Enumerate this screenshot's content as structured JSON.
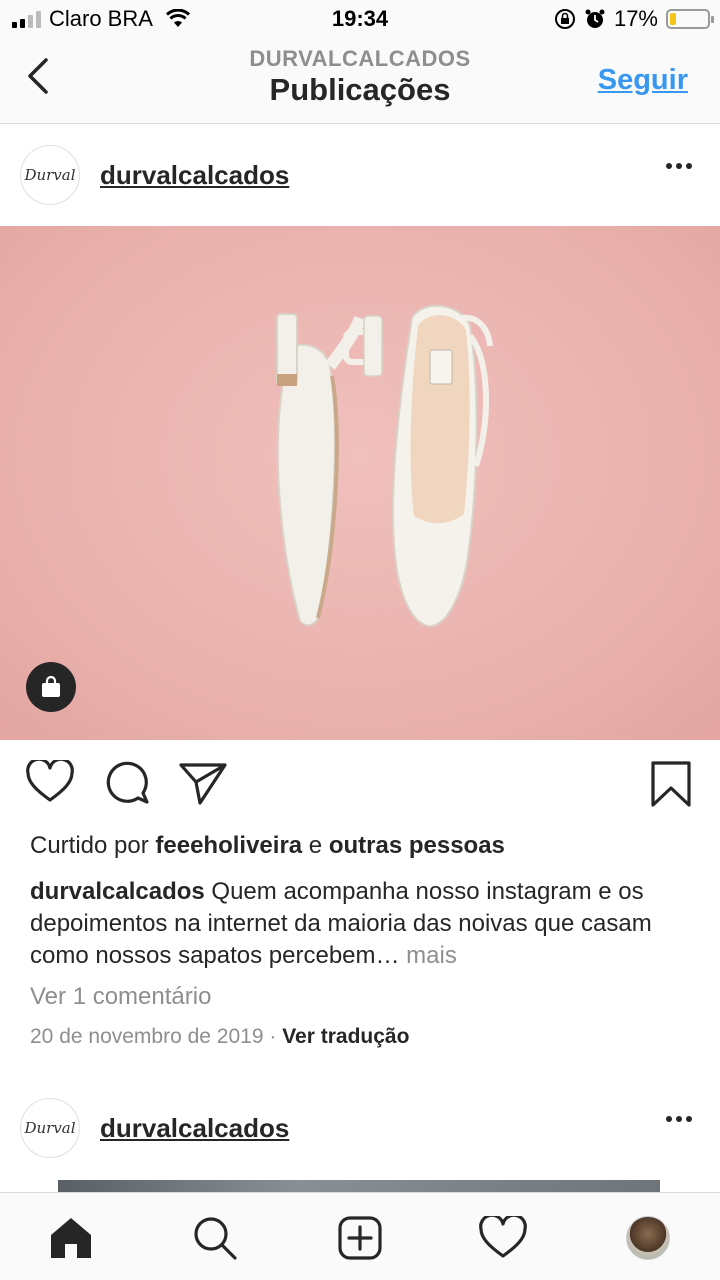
{
  "status_bar": {
    "carrier": "Claro BRA",
    "time": "19:34",
    "battery": "17%",
    "battery_level": 0.17
  },
  "header": {
    "account": "DURVALCALCADOS",
    "title": "Publicações",
    "follow_label": "Seguir"
  },
  "post": {
    "username": "durvalcalcados",
    "avatar_text": "Durval",
    "liked_by_prefix": "Curtido por ",
    "liked_by_user": "feeeholiveira",
    "liked_by_connector": " e ",
    "liked_by_others": "outras pessoas",
    "caption_user": "durvalcalcados",
    "caption_text": " Quem acompanha nosso instagram e os depoimentos na internet da maioria das noivas que casam como nossos sapatos percebem…",
    "caption_more": " mais",
    "view_comments": "Ver 1 comentário",
    "date": "20 de novembro de 2019",
    "date_separator": " · ",
    "translate_label": "Ver tradução"
  },
  "next_post": {
    "username": "durvalcalcados",
    "avatar_text": "Durval"
  },
  "icons": {
    "back": "chevron-left-icon",
    "more": "more-options-icon",
    "shop": "shopping-bag-icon",
    "like": "heart-icon",
    "comment": "comment-icon",
    "share": "send-icon",
    "save": "bookmark-icon",
    "home": "home-icon",
    "search": "search-icon",
    "new_post": "add-post-icon",
    "activity": "heart-icon",
    "profile": "profile-avatar"
  },
  "colors": {
    "link_blue": "#3897f0",
    "photo_pink": "#eab2ae",
    "battery_yellow": "#f5c518"
  }
}
